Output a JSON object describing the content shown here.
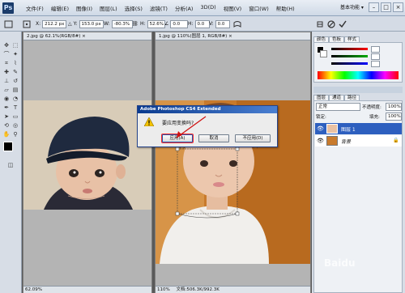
{
  "menubar": {
    "items": [
      "文件(F)",
      "编辑(E)",
      "图像(I)",
      "图层(L)",
      "选择(S)",
      "滤镜(T)",
      "分析(A)",
      "3D(D)",
      "视图(V)",
      "窗口(W)",
      "帮助(H)"
    ],
    "workspace": "基本功能 ▾"
  },
  "options": {
    "x_label": "X:",
    "x_value": "212.2 px",
    "y_label": "Y:",
    "y_value": "153.0 px",
    "w_label": "W:",
    "w_value": "-80.3%",
    "h_label": "H:",
    "h_value": "52.6%",
    "angle_value": "0.0",
    "hskew_label": "H:",
    "hskew_value": "0.0",
    "vskew_label": "V:",
    "vskew_value": "0.0",
    "commit_icon": "checkmark-icon",
    "cancel_icon": "cancel-icon"
  },
  "doc_left": {
    "tab": "2.jpg @ 62.1%(RGB/8#) ×",
    "status_zoom": "62.09%"
  },
  "doc_right": {
    "tab": "1.jpg @ 110%(图层 1, RGB/8#) ×",
    "status_zoom": "110%",
    "status_info": "文档:506.3K/992.3K"
  },
  "dialog": {
    "title": "Adobe Photoshop CS4 Extended",
    "message": "要应用变换吗?",
    "apply": "应用(A)",
    "cancel": "取消",
    "dont_apply": "不应用(D)"
  },
  "panels": {
    "color_tabs": [
      "颜色",
      "色板",
      "样式"
    ],
    "layer_tabs": [
      "图层",
      "通道",
      "路径"
    ],
    "blend_mode": "正常",
    "opacity_label": "不透明度:",
    "opacity_value": "100%",
    "lock_label": "锁定:",
    "fill_label": "填充:",
    "fill_value": "100%",
    "layers": [
      {
        "name": "图层 1",
        "selected": true
      },
      {
        "name": "背景",
        "selected": false
      }
    ]
  },
  "colors": {
    "accent": "#2d5fbf",
    "dialog_title": "#0b3b8f",
    "arrow": "#d01010"
  }
}
